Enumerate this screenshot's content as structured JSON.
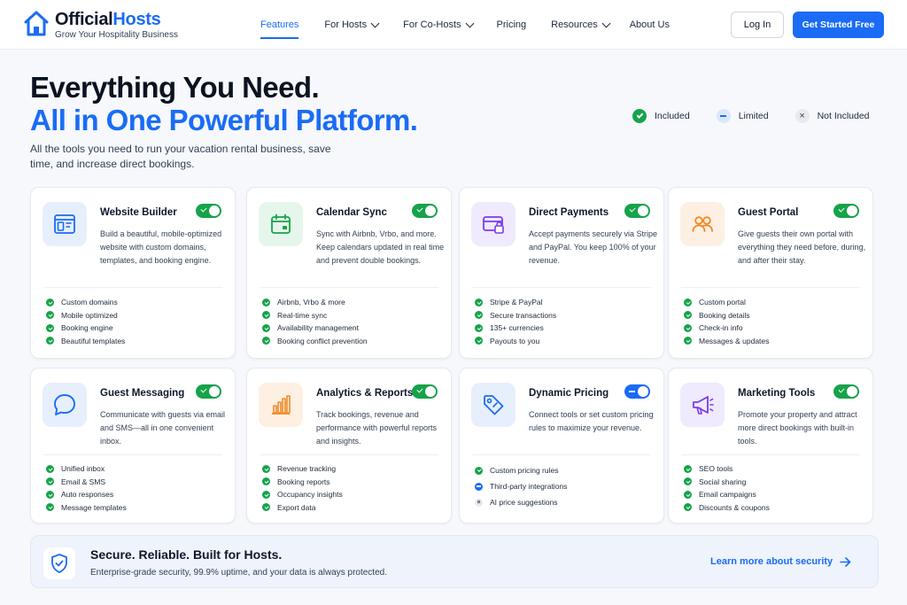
{
  "header": {
    "brand_name_part1": "Official",
    "brand_name_part2": "Hosts",
    "brand_tagline": "Grow Your Hospitality Business",
    "nav": [
      {
        "label": "Features",
        "active": true,
        "dropdown": false
      },
      {
        "label": "For Hosts",
        "active": false,
        "dropdown": true
      },
      {
        "label": "For Co-Hosts",
        "active": false,
        "dropdown": true
      },
      {
        "label": "Pricing",
        "active": false,
        "dropdown": false
      },
      {
        "label": "Resources",
        "active": false,
        "dropdown": true
      },
      {
        "label": "About Us",
        "active": false,
        "dropdown": false
      }
    ],
    "login_label": "Log In",
    "cta_label": "Get Started Free"
  },
  "hero": {
    "title_line1": "Everything You Need.",
    "title_line2": "All in One Powerful Platform.",
    "subtitle": "All the tools you need to run your vacation rental business, save time, and increase direct bookings."
  },
  "legend": {
    "included": "Included",
    "limited": "Limited",
    "not_included": "Not Included"
  },
  "features": [
    {
      "title": "Website Builder",
      "icon": "website-icon",
      "toggle": "included",
      "description": "Build a beautiful, mobile-optimized website with custom domains, templates, and booking engine.",
      "items": [
        {
          "label": "Custom domains",
          "status": "included"
        },
        {
          "label": "Mobile optimized",
          "status": "included"
        },
        {
          "label": "Booking engine",
          "status": "included"
        },
        {
          "label": "Beautiful templates",
          "status": "included"
        }
      ]
    },
    {
      "title": "Calendar Sync",
      "icon": "calendar-icon",
      "toggle": "included",
      "description": "Sync with Airbnb, Vrbo, and more. Keep calendars updated in real time and prevent double bookings.",
      "items": [
        {
          "label": "Airbnb, Vrbo & more",
          "status": "included"
        },
        {
          "label": "Real-time sync",
          "status": "included"
        },
        {
          "label": "Availability management",
          "status": "included"
        },
        {
          "label": "Booking conflict prevention",
          "status": "included"
        }
      ]
    },
    {
      "title": "Direct Payments",
      "icon": "secure-card-icon",
      "toggle": "included",
      "description": "Accept payments securely via Stripe and PayPal. You keep 100% of your revenue.",
      "items": [
        {
          "label": "Stripe & PayPal",
          "status": "included"
        },
        {
          "label": "Secure transactions",
          "status": "included"
        },
        {
          "label": "135+ currencies",
          "status": "included"
        },
        {
          "label": "Payouts to you",
          "status": "included"
        }
      ]
    },
    {
      "title": "Guest Portal",
      "icon": "users-icon",
      "toggle": "included",
      "description": "Give guests their own portal with everything they need before, during, and after their stay.",
      "items": [
        {
          "label": "Custom portal",
          "status": "included"
        },
        {
          "label": "Booking details",
          "status": "included"
        },
        {
          "label": "Check-in info",
          "status": "included"
        },
        {
          "label": "Messages & updates",
          "status": "included"
        }
      ]
    },
    {
      "title": "Guest Messaging",
      "icon": "chat-bubble-icon",
      "toggle": "included",
      "description": "Communicate with guests via email and SMS—all in one convenient inbox.",
      "items": [
        {
          "label": "Unified inbox",
          "status": "included"
        },
        {
          "label": "Email & SMS",
          "status": "included"
        },
        {
          "label": "Auto responses",
          "status": "included"
        },
        {
          "label": "Message templates",
          "status": "included"
        }
      ]
    },
    {
      "title": "Analytics & Reports",
      "icon": "bar-chart-icon",
      "toggle": "included",
      "description": "Track bookings, revenue and performance with powerful reports and insights.",
      "items": [
        {
          "label": "Revenue tracking",
          "status": "included"
        },
        {
          "label": "Booking reports",
          "status": "included"
        },
        {
          "label": "Occupancy insights",
          "status": "included"
        },
        {
          "label": "Export data",
          "status": "included"
        }
      ]
    },
    {
      "title": "Dynamic Pricing",
      "icon": "price-tag-icon",
      "toggle": "limited",
      "description": "Connect tools or set custom pricing rules to maximize your revenue.",
      "items": [
        {
          "label": "Custom pricing rules",
          "status": "included"
        },
        {
          "label": "Third-party integrations",
          "status": "limited"
        },
        {
          "label": "AI price suggestions",
          "status": "none"
        }
      ]
    },
    {
      "title": "Marketing Tools",
      "icon": "megaphone-icon",
      "toggle": "included",
      "description": "Promote your property and attract more direct bookings with built-in tools.",
      "items": [
        {
          "label": "SEO tools",
          "status": "included"
        },
        {
          "label": "Social sharing",
          "status": "included"
        },
        {
          "label": "Email campaigns",
          "status": "included"
        },
        {
          "label": "Discounts & coupons",
          "status": "included"
        }
      ]
    }
  ],
  "security": {
    "title": "Secure. Reliable. Built for Hosts.",
    "subtitle": "Enterprise-grade security, 99.9% uptime, and your data is always protected.",
    "link_label": "Learn more about security"
  },
  "colors": {
    "accent": "#1a6cf5",
    "included": "#16a34a",
    "limited": "#1a6cf5",
    "not_included": "#94a3b8"
  }
}
